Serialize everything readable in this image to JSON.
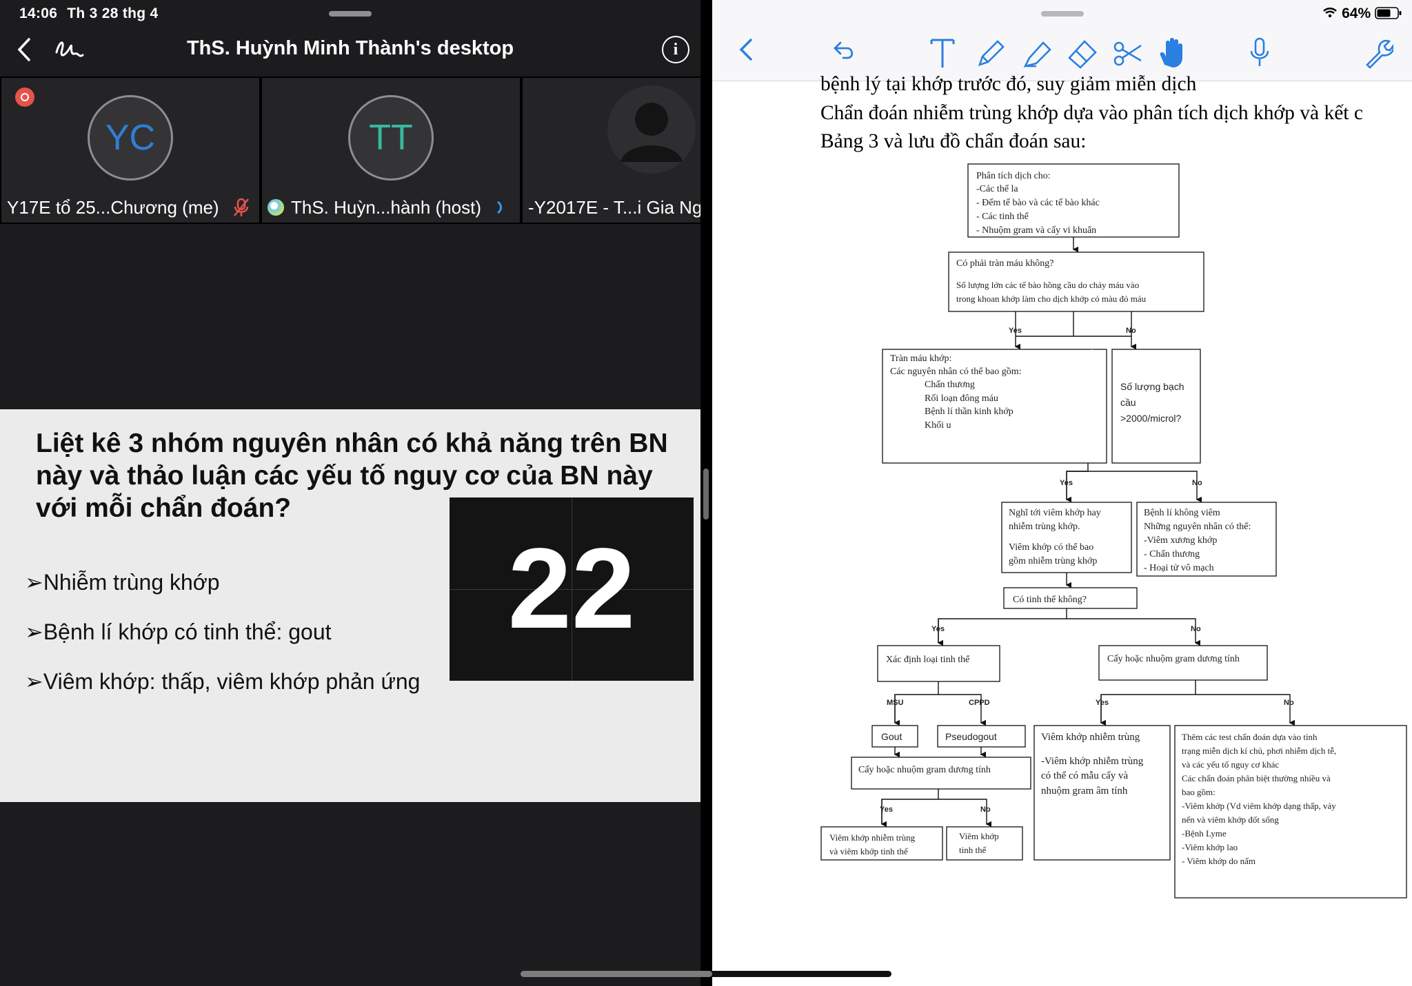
{
  "status_bar": {
    "time": "14:06",
    "date": "Th 3 28 thg 4",
    "battery": "64%"
  },
  "zoom": {
    "title": "ThS. Huỳnh Minh Thành's desktop",
    "info_label": "i",
    "participants": [
      {
        "initials": "YC",
        "name": "Y17E tổ 25...Chương (me)",
        "color": "#2f7fd8"
      },
      {
        "initials": "TT",
        "name": "ThS. Huỳn...hành (host)",
        "color": "#38b8a0"
      },
      {
        "initials": "",
        "name": "-Y2017E - T...i Gia Ng",
        "color": "#9a9a9a"
      }
    ],
    "slide": {
      "question": "Liệt kê 3 nhóm nguyên nhân có khả năng trên BN này và thảo luận các yếu tố nguy cơ của BN này với mỗi chẩn đoán?",
      "bullets": [
        "➢Nhiễm trùng khớp",
        "➢Bệnh lí khớp có tinh thể: gout",
        "➢Viêm khớp: thấp, viêm khớp phản ứng"
      ],
      "timer": "22"
    }
  },
  "notes": {
    "text_lines": [
      "bệnh lý tại khớp trước đó, suy giảm miễn dịch",
      "Chẩn đoán nhiễm trùng khớp dựa vào phân tích dịch khớp và kết c",
      "Bảng 3 và lưu đồ chẩn đoán sau:"
    ],
    "flowchart": {
      "box1": [
        "Phân tích dịch cho:",
        "-Các thể la",
        "- Đếm tế bào và các tế bào khác",
        "- Các tinh thể",
        "- Nhuộm gram và cấy vi khuẩn"
      ],
      "box2": [
        "Có phải tràn máu không?",
        "Số lượng lớn các tế bào hồng cầu do chảy máu vào",
        "trong khoan khớp làm cho dịch khớp có màu đỏ máu"
      ],
      "box3": [
        "Tràn máu khớp:",
        "Các nguyên nhân có thể bao gồm:",
        "Chấn thương",
        "Rối loạn đông máu",
        "Bệnh lí thần kinh khớp",
        "Khối u"
      ],
      "box4": [
        "Số lượng bạch",
        "cầu",
        ">2000/microl?"
      ],
      "box5": [
        "Nghĩ tới viêm khớp hay",
        "nhiễm trùng khớp.",
        "Viêm khớp có thể bao",
        "gồm nhiễm trùng khớp"
      ],
      "box6": [
        "Bệnh lí không viêm",
        "Những nguyên nhân có thể:",
        "-Viêm xương khớp",
        "- Chấn thương",
        "- Hoại tử vô mạch"
      ],
      "box7": "Có tinh thể không?",
      "box8": "Xác định loại tinh thể",
      "box9": "Cấy hoặc nhuộm gram dương tính",
      "box10": "Gout",
      "box11": "Pseudogout",
      "box12": "Cấy hoặc nhuộm gram dương tính",
      "box13": [
        "Viêm khớp nhiễm trùng",
        "-Viêm khớp nhiễm trùng",
        "có thể có mẫu cấy và",
        "nhuộm gram âm tính"
      ],
      "box14": [
        "Thêm các test chẩn đoán dựa vào tình",
        "trạng miễn dịch kí chủ, phơi nhiễm dịch tễ,",
        "và các yếu tố nguy cơ khác",
        "Các chẩn đoán phân biệt thường nhiều và",
        "bao gồm:",
        "-Viêm khớp (Vd viêm khớp dạng thấp, vảy",
        "nến và viêm khớp đốt sống",
        "-Bệnh Lyme",
        "-Viêm khớp lao",
        "- Viêm khớp do nấm"
      ],
      "box15": [
        "Viêm khớp nhiễm trùng",
        "và viêm khớp tinh thể"
      ],
      "box16": [
        "Viêm khớp",
        "tinh thể"
      ],
      "yes": "Yes",
      "no": "No",
      "msu": "MSU",
      "cppd": "CPPD"
    }
  }
}
